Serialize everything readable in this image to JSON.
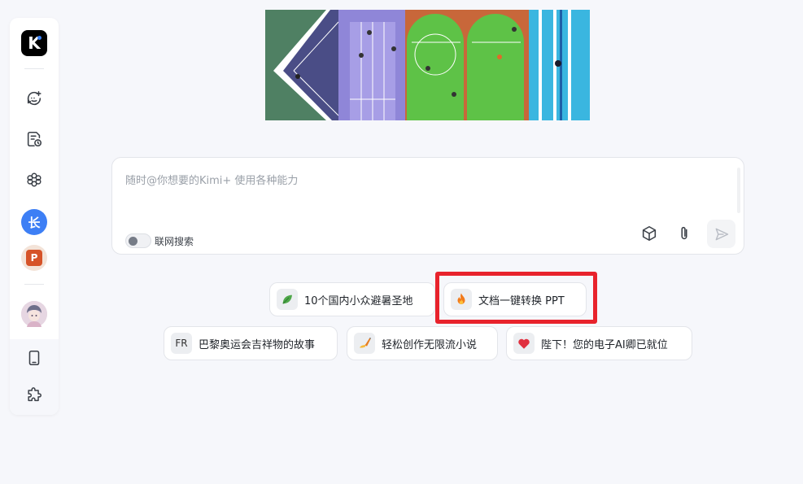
{
  "app": {
    "logo_letter": "K"
  },
  "sidebar": {
    "items": [
      {
        "name": "new-chat",
        "icon": "new-chat-icon"
      },
      {
        "name": "history",
        "icon": "history-icon"
      },
      {
        "name": "kimi-plus",
        "icon": "kimi-plus-icon"
      },
      {
        "name": "long-text",
        "icon": "long-text-avatar",
        "label": "长"
      },
      {
        "name": "ppt",
        "icon": "ppt-avatar",
        "label": "P"
      },
      {
        "name": "user",
        "icon": "user-avatar"
      },
      {
        "name": "mobile",
        "icon": "mobile-icon"
      },
      {
        "name": "plugins",
        "icon": "puzzle-icon"
      }
    ]
  },
  "input": {
    "placeholder": "随时@你想要的Kimi+ 使用各种能力",
    "web_search_label": "联网搜索",
    "web_search_enabled": false
  },
  "suggestions": [
    {
      "icon": "leaf-icon",
      "label": "10个国内小众避暑圣地"
    },
    {
      "icon": "fire-icon",
      "label": "文档一键转换 PPT",
      "highlighted": true
    },
    {
      "icon": "fr-text-icon",
      "icon_text": "FR",
      "label": "巴黎奥运会吉祥物的故事"
    },
    {
      "icon": "writing-hand-icon",
      "label": "轻松创作无限流小说"
    },
    {
      "icon": "heart-icon",
      "label": "陛下！您的电子AI卿已就位"
    }
  ],
  "colors": {
    "highlight": "#e8232c",
    "background": "#f6f7fb",
    "logo_bg": "#000000"
  }
}
